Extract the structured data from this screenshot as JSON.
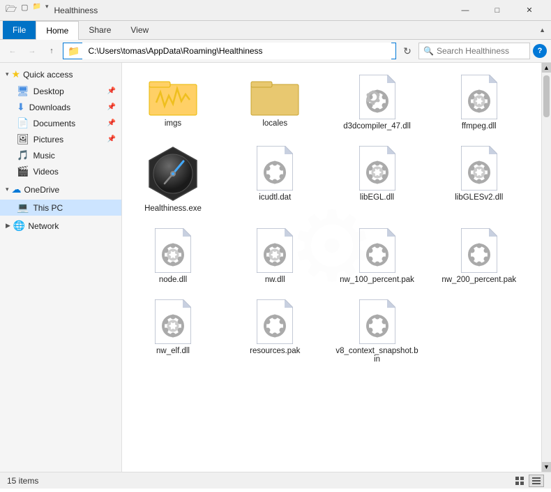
{
  "window": {
    "title": "Healthiness",
    "title_full": "C:\\Users\\tomas\\AppData\\Roaming\\Healthiness"
  },
  "ribbon": {
    "file_label": "File",
    "tabs": [
      "Home",
      "Share",
      "View"
    ]
  },
  "address_bar": {
    "path": "C:\\Users\\tomas\\AppData\\Roaming\\Healthiness",
    "search_placeholder": "Search Healthiness"
  },
  "sidebar": {
    "quick_access_label": "Quick access",
    "items_quick": [
      {
        "id": "desktop",
        "label": "Desktop",
        "pinned": true
      },
      {
        "id": "downloads",
        "label": "Downloads",
        "pinned": true
      },
      {
        "id": "documents",
        "label": "Documents",
        "pinned": true
      },
      {
        "id": "pictures",
        "label": "Pictures",
        "pinned": true
      },
      {
        "id": "music",
        "label": "Music"
      },
      {
        "id": "videos",
        "label": "Videos"
      }
    ],
    "onedrive_label": "OneDrive",
    "this_pc_label": "This PC",
    "network_label": "Network"
  },
  "files": [
    {
      "id": "imgs",
      "name": "imgs",
      "type": "folder_special"
    },
    {
      "id": "locales",
      "name": "locales",
      "type": "folder"
    },
    {
      "id": "d3dcompiler_47",
      "name": "d3dcompiler_47.dll",
      "type": "dll"
    },
    {
      "id": "ffmpeg",
      "name": "ffmpeg.dll",
      "type": "dll"
    },
    {
      "id": "healthiness_exe",
      "name": "Healthiness.exe",
      "type": "exe"
    },
    {
      "id": "icudtl",
      "name": "icudtl.dat",
      "type": "dll"
    },
    {
      "id": "libEGL",
      "name": "libEGL.dll",
      "type": "dll"
    },
    {
      "id": "libGLESv2",
      "name": "libGLESv2.dll",
      "type": "dll"
    },
    {
      "id": "node",
      "name": "node.dll",
      "type": "dll"
    },
    {
      "id": "nw",
      "name": "nw.dll",
      "type": "dll"
    },
    {
      "id": "nw_100",
      "name": "nw_100_percent.pak",
      "type": "dll"
    },
    {
      "id": "nw_200",
      "name": "nw_200_percent.pak",
      "type": "dll"
    },
    {
      "id": "nw_elf",
      "name": "nw_elf.dll",
      "type": "dll"
    },
    {
      "id": "resources",
      "name": "resources.pak",
      "type": "dll"
    },
    {
      "id": "v8_context",
      "name": "v8_context_snapshot.bin",
      "type": "dll"
    }
  ],
  "status": {
    "item_count": "15 items"
  },
  "icons": {
    "back": "←",
    "forward": "→",
    "up": "↑",
    "chevron_right": "›",
    "chevron_down": "⌄",
    "refresh": "↻",
    "search": "🔍",
    "help": "?",
    "minimize": "—",
    "maximize": "□",
    "close": "✕",
    "grid_view": "⊞",
    "list_view": "≡"
  }
}
